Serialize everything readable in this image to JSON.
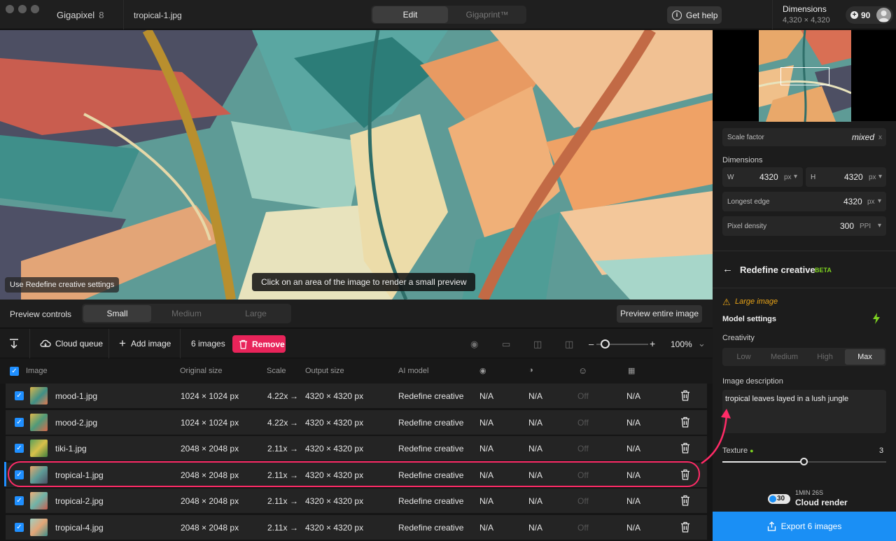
{
  "titlebar": {
    "app_name": "Gigapixel",
    "app_version": "8",
    "file_name": "tropical-1.jpg",
    "tabs": [
      {
        "label": "Edit",
        "active": true
      },
      {
        "label": "Gigaprint™",
        "active": false
      }
    ],
    "help_label": "Get help",
    "dimensions_title": "Dimensions",
    "dimensions_value": "4,320 × 4,320",
    "credits": "90"
  },
  "preview": {
    "use_redefine_label": "Use Redefine creative settings",
    "hint": "Click on an area of the image to render a small preview"
  },
  "preview_controls": {
    "label": "Preview controls",
    "options": [
      "Small",
      "Medium",
      "Large"
    ],
    "selected": "Small",
    "preview_all_label": "Preview entire image"
  },
  "toolbar": {
    "cloud_queue_label": "Cloud queue",
    "add_image_label": "Add image",
    "image_count": "6 images",
    "remove_label": "Remove",
    "zoom": "100%"
  },
  "table": {
    "headers": {
      "image": "Image",
      "original_size": "Original size",
      "scale": "Scale",
      "output_size": "Output size",
      "ai_model": "AI model"
    },
    "rows": [
      {
        "name": "mood-1.jpg",
        "original": "1024 × 1024 px",
        "scale": "4.22x",
        "output": "4320 × 4320 px",
        "model": "Redefine creative",
        "c1": "N/A",
        "c2": "N/A",
        "c3": "Off",
        "c4": "N/A"
      },
      {
        "name": "mood-2.jpg",
        "original": "1024 × 1024 px",
        "scale": "4.22x",
        "output": "4320 × 4320 px",
        "model": "Redefine creative",
        "c1": "N/A",
        "c2": "N/A",
        "c3": "Off",
        "c4": "N/A"
      },
      {
        "name": "tiki-1.jpg",
        "original": "2048 × 2048 px",
        "scale": "2.11x",
        "output": "4320 × 4320 px",
        "model": "Redefine creative",
        "c1": "N/A",
        "c2": "N/A",
        "c3": "Off",
        "c4": "N/A"
      },
      {
        "name": "tropical-1.jpg",
        "original": "2048 × 2048 px",
        "scale": "2.11x",
        "output": "4320 × 4320 px",
        "model": "Redefine creative",
        "c1": "N/A",
        "c2": "N/A",
        "c3": "Off",
        "c4": "N/A"
      },
      {
        "name": "tropical-2.jpg",
        "original": "2048 × 2048 px",
        "scale": "2.11x",
        "output": "4320 × 4320 px",
        "model": "Redefine creative",
        "c1": "N/A",
        "c2": "N/A",
        "c3": "Off",
        "c4": "N/A"
      },
      {
        "name": "tropical-4.jpg",
        "original": "2048 × 2048 px",
        "scale": "2.11x",
        "output": "4320 × 4320 px",
        "model": "Redefine creative",
        "c1": "N/A",
        "c2": "N/A",
        "c3": "Off",
        "c4": "N/A"
      }
    ],
    "selected_row": 3
  },
  "right_panel": {
    "scale_factor_label": "Scale factor",
    "scale_factor_value": "mixed",
    "scale_factor_close": "x",
    "dimensions_label": "Dimensions",
    "w_label": "W",
    "w_value": "4320",
    "w_unit": "px",
    "h_label": "H",
    "h_value": "4320",
    "h_unit": "px",
    "longest_edge_label": "Longest edge",
    "longest_edge_value": "4320",
    "longest_edge_unit": "px",
    "pixel_density_label": "Pixel density",
    "pixel_density_value": "300",
    "pixel_density_unit": "PPI",
    "model_title": "Redefine creative",
    "model_badge": "BETA",
    "warning": "Large image",
    "model_settings_label": "Model settings",
    "creativity_label": "Creativity",
    "creativity_options": [
      "Low",
      "Medium",
      "High",
      "Max"
    ],
    "creativity_selected": "Max",
    "description_label": "Image description",
    "description_value": "tropical leaves layed in a lush jungle",
    "texture_label": "Texture",
    "texture_value": "3",
    "texture_level": 0.5,
    "cloud_credits": "30",
    "cloud_time": "1MIN 26S",
    "cloud_label": "Cloud render",
    "export_label": "Export 6 images"
  },
  "colors": {
    "accent": "#1a8ff5",
    "remove": "#e8245a",
    "annotation": "#ff2b67",
    "beta": "#7ed321",
    "warning": "#e8a317"
  }
}
